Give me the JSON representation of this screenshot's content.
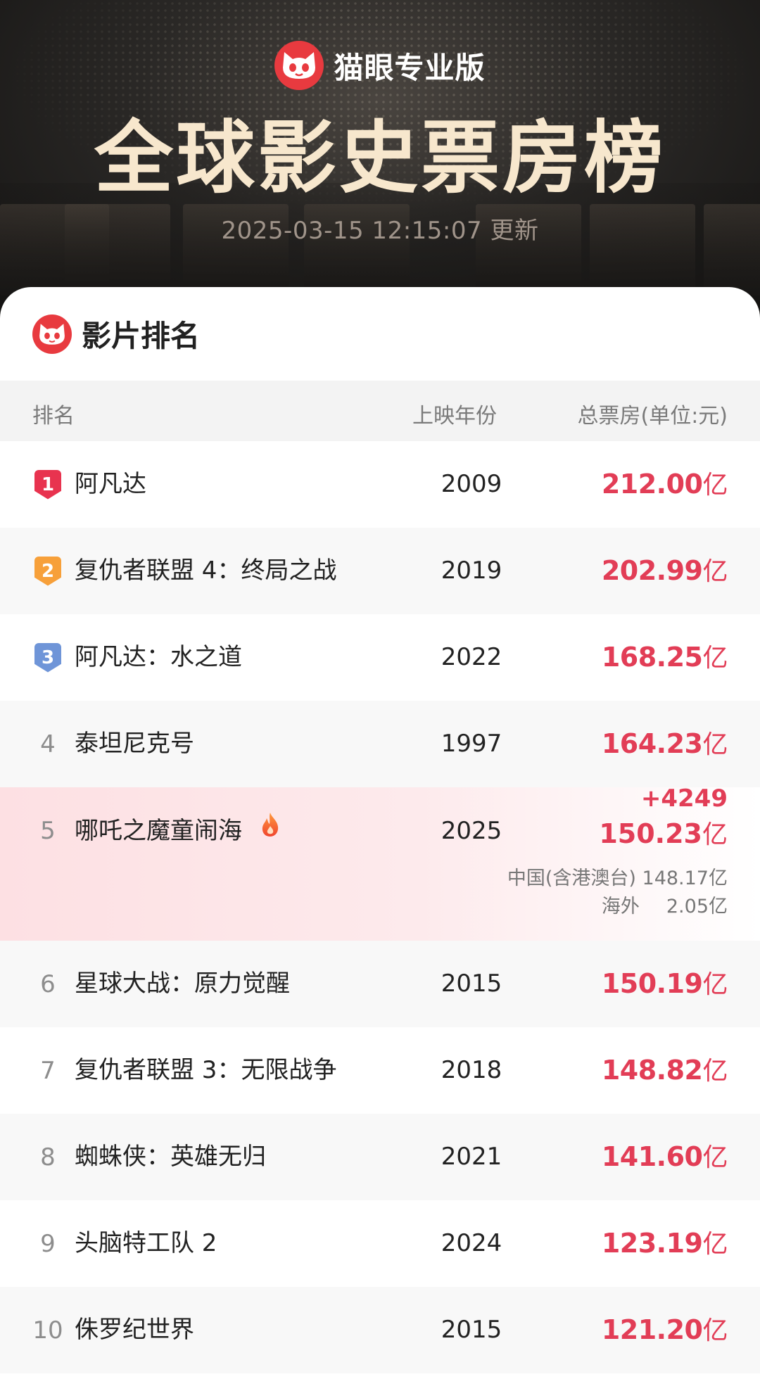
{
  "header": {
    "brand_name": "猫眼专业版",
    "title": "全球影史票房榜",
    "updated": "2025-03-15 12:15:07 更新"
  },
  "card": {
    "title": "影片排名",
    "columns": {
      "rank": "排名",
      "year": "上映年份",
      "gross": "总票房(单位:元)"
    }
  },
  "colors": {
    "accent": "#e23d56",
    "brand": "#e83a3f",
    "gold": "#f7e7cd"
  },
  "rows": [
    {
      "rank": "1",
      "name": "阿凡达",
      "year": "2009",
      "gross": "212.00",
      "unit": "亿"
    },
    {
      "rank": "2",
      "name": "复仇者联盟 4：终局之战",
      "year": "2019",
      "gross": "202.99",
      "unit": "亿"
    },
    {
      "rank": "3",
      "name": "阿凡达：水之道",
      "year": "2022",
      "gross": "168.25",
      "unit": "亿"
    },
    {
      "rank": "4",
      "name": "泰坦尼克号",
      "year": "1997",
      "gross": "164.23",
      "unit": "亿"
    },
    {
      "rank": "5",
      "name": "哪吒之魔童闹海",
      "year": "2025",
      "gross": "150.23",
      "unit": "亿",
      "delta": "+4249",
      "china_label": "中国(含港澳台)",
      "china_value": "148.17亿",
      "overseas_label": "海外",
      "overseas_value": "2.05亿"
    },
    {
      "rank": "6",
      "name": "星球大战：原力觉醒",
      "year": "2015",
      "gross": "150.19",
      "unit": "亿"
    },
    {
      "rank": "7",
      "name": "复仇者联盟 3：无限战争",
      "year": "2018",
      "gross": "148.82",
      "unit": "亿"
    },
    {
      "rank": "8",
      "name": "蜘蛛侠：英雄无归",
      "year": "2021",
      "gross": "141.60",
      "unit": "亿"
    },
    {
      "rank": "9",
      "name": "头脑特工队 2",
      "year": "2024",
      "gross": "123.19",
      "unit": "亿"
    },
    {
      "rank": "10",
      "name": "侏罗纪世界",
      "year": "2015",
      "gross": "121.20",
      "unit": "亿"
    }
  ]
}
